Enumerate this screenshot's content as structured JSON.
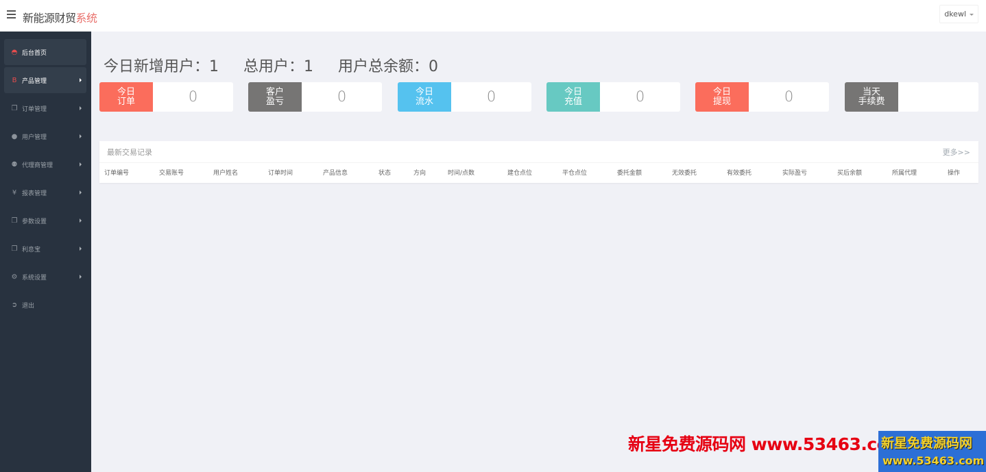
{
  "header": {
    "brand_main": "新能源财贸",
    "brand_accent": "系统",
    "user": "dkewl",
    "accent_color": "#e9706b"
  },
  "sidebar": {
    "items": [
      {
        "label": "后台首页",
        "icon": "dashboard-icon",
        "active": true,
        "has_arrow": false
      },
      {
        "label": "产品管理",
        "icon": "bitcoin-icon",
        "active": true,
        "has_arrow": true
      },
      {
        "label": "订单管理",
        "icon": "copy-icon",
        "active": false,
        "has_arrow": true
      },
      {
        "label": "用户管理",
        "icon": "user-icon",
        "active": false,
        "has_arrow": true
      },
      {
        "label": "代理商管理",
        "icon": "sitemap-icon",
        "active": false,
        "has_arrow": true
      },
      {
        "label": "报表管理",
        "icon": "yen-icon",
        "active": false,
        "has_arrow": true
      },
      {
        "label": "参数设置",
        "icon": "copy-icon",
        "active": false,
        "has_arrow": true
      },
      {
        "label": "利息宝",
        "icon": "copy-icon",
        "active": false,
        "has_arrow": true
      },
      {
        "label": "系统设置",
        "icon": "gears-icon",
        "active": false,
        "has_arrow": true
      },
      {
        "label": "退出",
        "icon": "sign-out-icon",
        "active": false,
        "has_arrow": false
      }
    ]
  },
  "summary": {
    "new_users_today": "今日新增用户：1",
    "total_users": "总用户：1",
    "total_balance": "用户总余额：0"
  },
  "cards": [
    {
      "line1": "今日",
      "line2": "订单",
      "value": "0",
      "color": "#fb6d5c"
    },
    {
      "line1": "客户",
      "line2": "盈亏",
      "value": "0",
      "color": "#767574"
    },
    {
      "line1": "今日",
      "line2": "流水",
      "value": "0",
      "color": "#55c2ef"
    },
    {
      "line1": "今日",
      "line2": "充值",
      "value": "0",
      "color": "#67c9c2"
    },
    {
      "line1": "今日",
      "line2": "提现",
      "value": "0",
      "color": "#fb6d5c"
    },
    {
      "line1": "当天",
      "line2": "手续费",
      "value": "",
      "color": "#767574"
    }
  ],
  "trades": {
    "title": "最新交易记录",
    "more": "更多>>",
    "columns": [
      "订单编号",
      "交易账号",
      "用户姓名",
      "订单时间",
      "产品信息",
      "状态",
      "方向",
      "时间/点数",
      "建仓点位",
      "平仓点位",
      "委托金额",
      "无效委托",
      "有效委托",
      "实际盈亏",
      "买后余额",
      "所属代理",
      "操作"
    ],
    "rows": []
  },
  "watermark": {
    "text": "新星免费源码网  www.53463.com",
    "badge_line1": "新星免费源码网",
    "badge_line2": "www.53463.com"
  }
}
